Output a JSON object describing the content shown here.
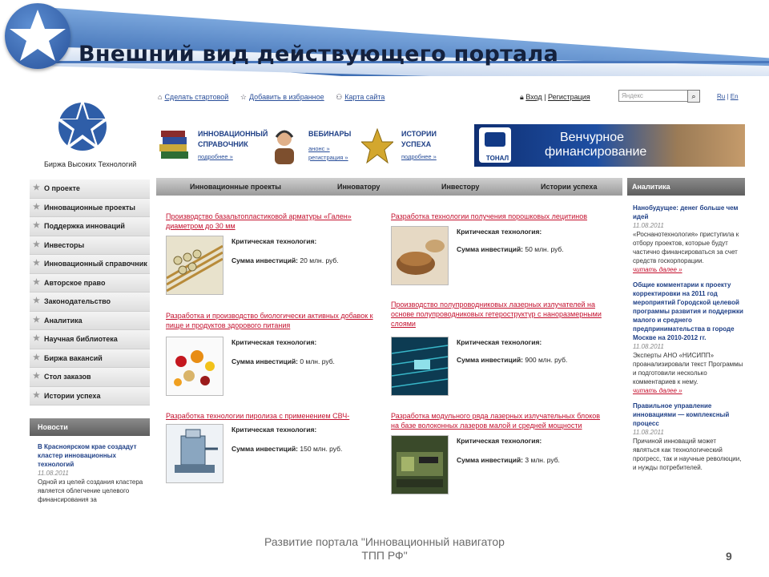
{
  "slide": {
    "title": "Внешний вид действующего портала",
    "footer": "Развитие портала \"Инновационный навигатор ТПП РФ\"",
    "page_number": "9"
  },
  "portal": {
    "logo_caption": "Биржа Высоких Технологий",
    "top_links": [
      "Сделать стартовой",
      "Добавить в избранное",
      "Карта сайта"
    ],
    "login": {
      "enter": "Вход",
      "sep": " | ",
      "register": "Регистрация"
    },
    "search_placeholder": "Яндекс",
    "lang": {
      "ru": "Ru",
      "sep": " | ",
      "en": "En"
    },
    "promos": [
      {
        "title1": "ИННОВАЦИОННЫЙ",
        "title2": "СПРАВОЧНИК",
        "link1": "подробнее »",
        "link2": ""
      },
      {
        "title1": "ВЕБИНАРЫ",
        "title2": "",
        "link1": "анонс »",
        "link2": "регистрация »"
      },
      {
        "title1": "ИСТОРИИ",
        "title2": "УСПЕХА",
        "link1": "подробнее »",
        "link2": ""
      }
    ],
    "banner": {
      "brand": "ТОНАЛ",
      "line1": "Венчурное",
      "line2": "финансирование"
    },
    "left_nav": [
      "О проекте",
      "Инновационные проекты",
      "Поддержка инноваций",
      "Инвесторы",
      "Инновационный справочник",
      "Авторское право",
      "Законодательство",
      "Аналитика",
      "Научная библиотека",
      "Биржа вакансий",
      "Стол заказов",
      "Истории успеха"
    ],
    "news": {
      "header": "Новости",
      "title": "В Красноярском крае создадут кластер инновационных технологий",
      "date": "11.08.2011",
      "text": "Одной из целей создания кластера является облегчение целевого финансирования за"
    },
    "center_tabs": [
      "Инновационные проекты",
      "Инноватору",
      "Инвестору",
      "Истории успеха"
    ],
    "projects": [
      {
        "title": "Производство базальтопластиковой арматуры «Гален» диаметром до 30 мм",
        "tech_label": "Критическая технология:",
        "sum_label": "Сумма инвестиций:",
        "sum": "20 млн. руб."
      },
      {
        "title": "Разработка технологии получения порошковых лецитинов",
        "tech_label": "Критическая технология:",
        "sum_label": "Сумма инвестиций:",
        "sum": "50 млн. руб."
      },
      {
        "title": "Разработка и производство биологически активных добавок к пище и продуктов здорового питания",
        "tech_label": "Критическая технология:",
        "sum_label": "Сумма инвестиций:",
        "sum": "0 млн. руб."
      },
      {
        "title": "Производство полупроводниковых лазерных излучателей на основе полупроводниковых гетероструктур с наноразмерными слоями",
        "tech_label": "Критическая технология:",
        "sum_label": "Сумма инвестиций:",
        "sum": "900 млн. руб."
      },
      {
        "title": "Разработка технологии пиролиза с применением СВЧ-излучения",
        "tech_label": "Критическая технология:",
        "sum_label": "Сумма инвестиций:",
        "sum": "150 млн. руб."
      },
      {
        "title": "Разработка модульного ряда лазерных излучательных блоков на базе волоконных лазеров малой и средней мощности",
        "tech_label": "Критическая технология:",
        "sum_label": "Сумма инвестиций:",
        "sum": "3 млн. руб."
      }
    ],
    "analytics": {
      "header": "Аналитика",
      "items": [
        {
          "title": "Нанобудущее: денег больше чем идей",
          "date": "11.08.2011",
          "text": "«Роснанотехнология» приступила к отбору проектов, которые будут частично финансироваться за счет средств госкорпорации.",
          "more": "читать далее »"
        },
        {
          "title": "Общие комментарии к проекту корректировки на 2011 год мероприятий Городской целевой программы развития и поддержки малого и среднего предпринимательства в городе Москве на 2010-2012 гг.",
          "date": "11.08.2011",
          "text": "Эксперты АНО «НИСИПП» проанализировали текст Программы и подготовили несколько комментариев к нему.",
          "more": "читать далее »"
        },
        {
          "title": "Правильное управление инновациями — комплексный процесс",
          "date": "11.08.2011",
          "text": "Причиной инноваций может являться как технологический прогресс, так и научные революции, и нужды потребителей.",
          "more": ""
        }
      ]
    }
  }
}
